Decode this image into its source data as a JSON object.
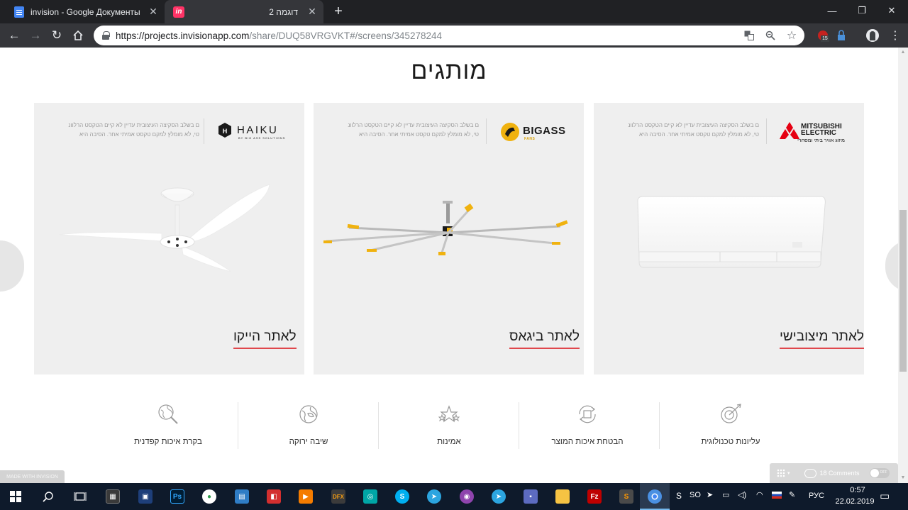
{
  "browser": {
    "tabs": [
      {
        "title": "invision - Google Документы",
        "favicon": "google-docs-icon",
        "active": false
      },
      {
        "title": "דוגמה 2",
        "favicon": "invision-icon",
        "active": true
      }
    ],
    "new_tab": "+",
    "url": {
      "host": "https://projects.invisionapp.com",
      "path": "/share/DUQ58VRGVKT#/screens/345278244"
    },
    "badge_count": "15"
  },
  "page": {
    "title": "מותגים",
    "cards": [
      {
        "id": "mitsubishi",
        "logo_lines": [
          "MITSUBISHI",
          "ELECTRIC"
        ],
        "logo_sub": "מיזוג אוויר ביתי ומסחרי",
        "text_line1": "ם בשלב הסקיצה העיצובית עדיין לא קיים הטקסט הרלוונ",
        "text_line2": "טי, לא מומלץ למקם טקסט אמיתי אחר. הסיבה היא",
        "link": "לאתר מיצובישי"
      },
      {
        "id": "bigass",
        "logo_text": "BIGASS",
        "logo_sub": "FANS",
        "text_line1": "ם בשלב הסקיצה העיצובית עדיין לא קיים הטקסט הרלוונ",
        "text_line2": "טי, לא מומלץ למקם טקסט אמיתי אחר. הסיבה היא",
        "link": "לאתר ביגאס"
      },
      {
        "id": "haiku",
        "logo_text": "HAIKU",
        "logo_sub": "BY BIG ASS SOLUTIONS",
        "text_line1": "ם בשלב הסקיצה העיצובית עדיין לא קיים הטקסט הרלוונ",
        "text_line2": "טי, לא מומלץ למקם טקסט אמיתי אחר. הסיבה היא",
        "link": "לאתר הייקו"
      }
    ],
    "features": [
      {
        "label": "עליונות טכנולוגית",
        "icon": "target-arrow-icon"
      },
      {
        "label": "הבטחת איכות המוצר",
        "icon": "quality-cycle-icon"
      },
      {
        "label": "אמינות",
        "icon": "stars-icon"
      },
      {
        "label": "שיבה ירוקה",
        "icon": "globe-leaf-icon"
      },
      {
        "label": "בקרת איכות קפדנית",
        "icon": "magnifier-globe-icon"
      }
    ],
    "made_with": "MADE WITH  INVISION",
    "comments": {
      "label": "18 Comments",
      "toggle": "OFF"
    }
  },
  "taskbar": {
    "language": "РУС",
    "time": "0:57",
    "date": "22.02.2019",
    "tray_label": "SO"
  },
  "colors": {
    "accent_underline": "#e0474c",
    "card_bg": "#efefef",
    "chrome_dark": "#202124",
    "taskbar": "#0e1a2b"
  }
}
